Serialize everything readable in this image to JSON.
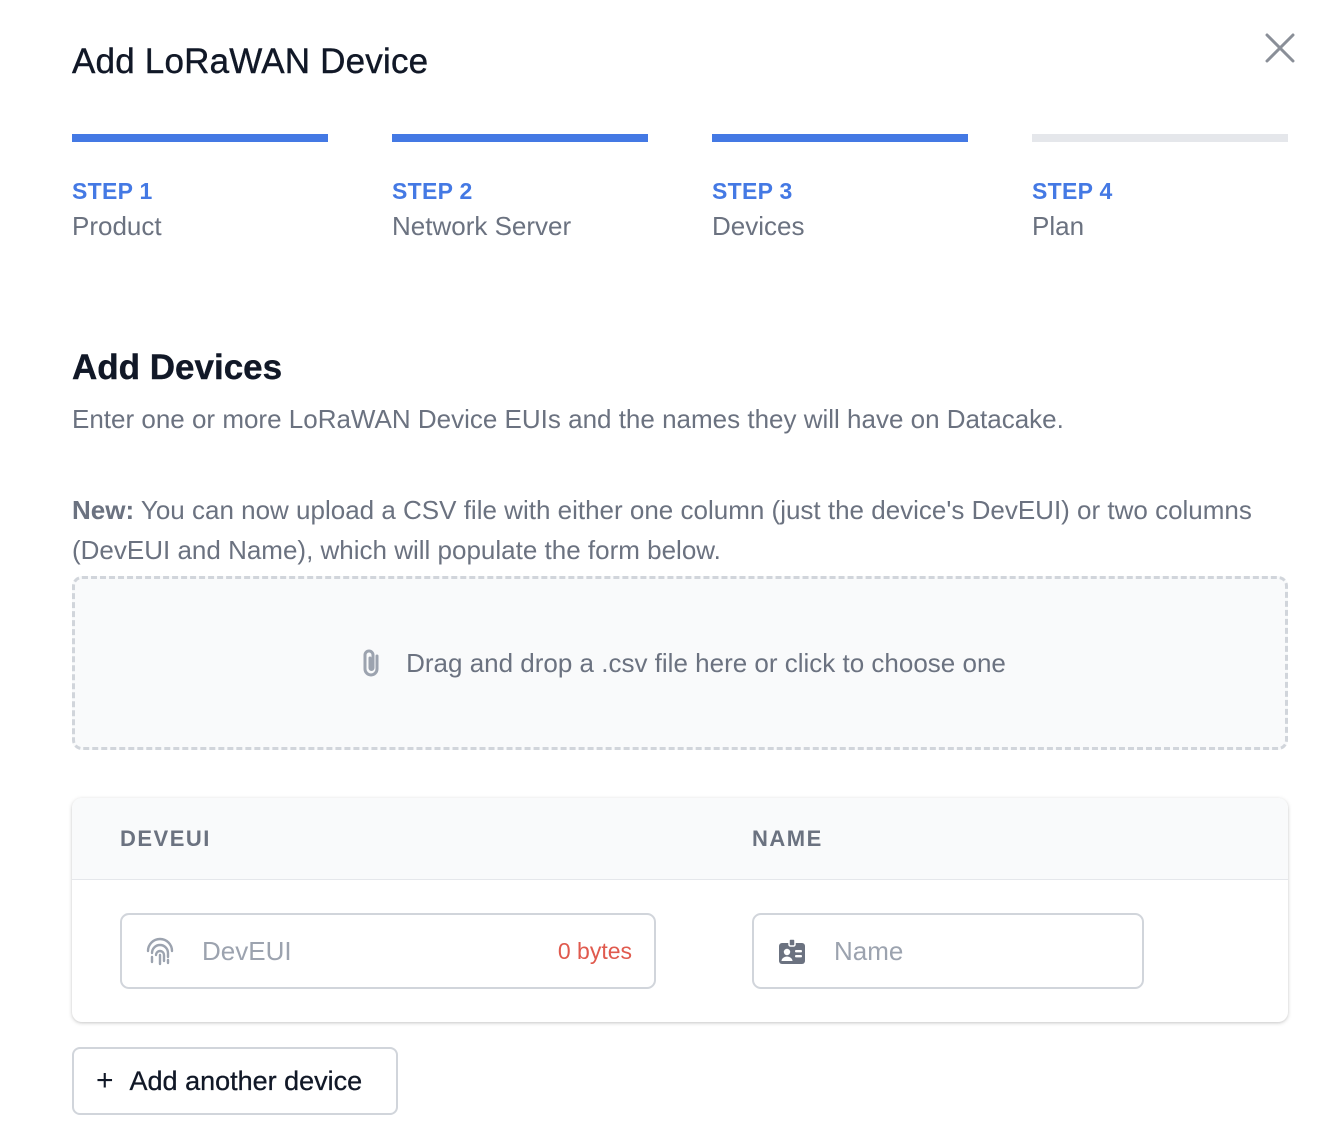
{
  "modal": {
    "title": "Add LoRaWAN Device",
    "close_icon": "close-icon"
  },
  "steps": [
    {
      "number": "STEP 1",
      "label": "Product",
      "complete": true
    },
    {
      "number": "STEP 2",
      "label": "Network Server",
      "complete": true
    },
    {
      "number": "STEP 3",
      "label": "Devices",
      "complete": true
    },
    {
      "number": "STEP 4",
      "label": "Plan",
      "complete": false
    }
  ],
  "colors": {
    "accent": "#4479e4",
    "inactive_bar": "#e5e7eb",
    "error_text": "#e05a4e"
  },
  "section": {
    "title": "Add Devices",
    "description": "Enter one or more LoRaWAN Device EUIs and the names they will have on Datacake.",
    "note_label": "New:",
    "note_text": " You can now upload a CSV file with either one column (just the device's DevEUI) or two columns (DevEUI and Name), which will populate the form below."
  },
  "dropzone": {
    "icon": "paperclip-icon",
    "text": "Drag and drop a .csv file here or click to choose one"
  },
  "table": {
    "columns": [
      "DEVEUI",
      "NAME"
    ],
    "rows": [
      {
        "deveui": {
          "value": "",
          "placeholder": "DevEUI",
          "icon": "fingerprint-icon",
          "bytes": "0 bytes"
        },
        "name": {
          "value": "",
          "placeholder": "Name",
          "icon": "id-badge-icon"
        }
      }
    ]
  },
  "add_button": {
    "icon": "plus-icon",
    "label": "Add another device"
  }
}
